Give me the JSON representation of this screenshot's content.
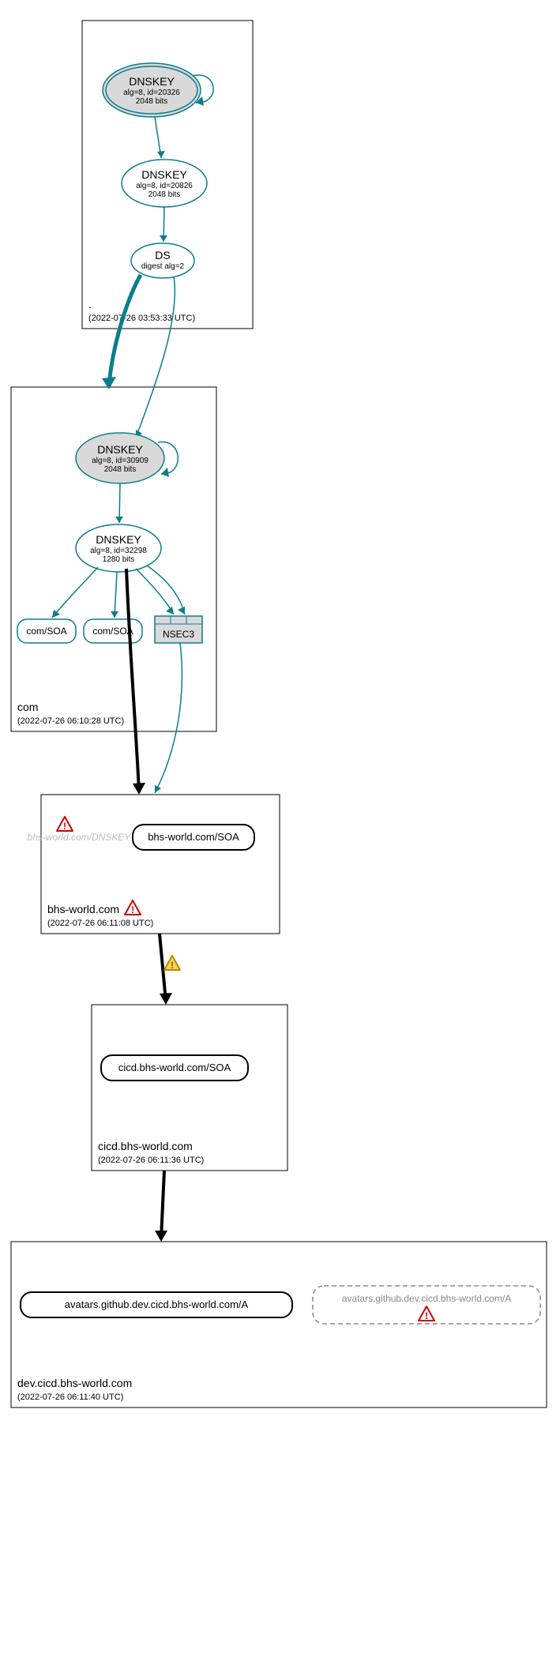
{
  "zones": {
    "root": {
      "label": ".",
      "timestamp": "(2022-07-26 03:53:33 UTC)"
    },
    "com": {
      "label": "com",
      "timestamp": "(2022-07-26 06:10:28 UTC)"
    },
    "bhsworld": {
      "label": "bhs-world.com",
      "timestamp": "(2022-07-26 06:11:08 UTC)"
    },
    "cicd": {
      "label": "cicd.bhs-world.com",
      "timestamp": "(2022-07-26 06:11:36 UTC)"
    },
    "devcicd": {
      "label": "dev.cicd.bhs-world.com",
      "timestamp": "(2022-07-26 06:11:40 UTC)"
    }
  },
  "nodes": {
    "dnskey_root1": {
      "title": "DNSKEY",
      "sub1": "alg=8, id=20326",
      "sub2": "2048 bits"
    },
    "dnskey_root2": {
      "title": "DNSKEY",
      "sub1": "alg=8, id=20826",
      "sub2": "2048 bits"
    },
    "ds_root": {
      "title": "DS",
      "sub1": "digest alg=2"
    },
    "dnskey_com1": {
      "title": "DNSKEY",
      "sub1": "alg=8, id=30909",
      "sub2": "2048 bits"
    },
    "dnskey_com2": {
      "title": "DNSKEY",
      "sub1": "alg=8, id=32298",
      "sub2": "1280 bits"
    },
    "com_soa1": {
      "label": "com/SOA"
    },
    "com_soa2": {
      "label": "com/SOA"
    },
    "nsec3": {
      "label": "NSEC3"
    },
    "bhs_dnskey": {
      "label": "bhs-world.com/DNSKEY"
    },
    "bhs_soa": {
      "label": "bhs-world.com/SOA"
    },
    "cicd_soa": {
      "label": "cicd.bhs-world.com/SOA"
    },
    "avatars_a": {
      "label": "avatars.github.dev.cicd.bhs-world.com/A"
    },
    "avatars_a_dashed": {
      "label": "avatars.github.dev.cicd.bhs-world.com/A"
    }
  }
}
